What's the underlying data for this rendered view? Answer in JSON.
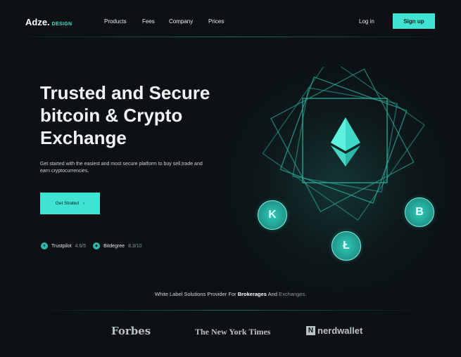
{
  "header": {
    "logo_main": "Adze.",
    "logo_sub": "DESIGN",
    "nav": [
      "Products",
      "Fees",
      "Company",
      "Prices"
    ],
    "login_label": "Log in",
    "signup_label": "Sign up"
  },
  "hero": {
    "title": "Trusted and Secure bitcoin & Crypto Exchange",
    "subtitle": "Get started with the easiest and most secure platform to buy sell,trade and earn cryptocurrencies.",
    "cta_label": "Get Strated",
    "cta_arrow": "›",
    "ratings": [
      {
        "name": "Trustpilot",
        "score": "4.6/5"
      },
      {
        "name": "Bitdegree",
        "score": "8.3/10"
      }
    ]
  },
  "coins": {
    "k_glyph": "K",
    "b_glyph": "B",
    "l_glyph": "Ł",
    "icons": [
      "ethereum-icon",
      "kyber-coin-icon",
      "bitcoin-coin-icon",
      "litecoin-coin-icon"
    ]
  },
  "partners": {
    "intro": "White Label Solutions Provider For",
    "bold": "Brokerages",
    "and": " And",
    "end": " Exchanges.",
    "brands": [
      "Forbes",
      "The New York Times",
      "nerdwallet"
    ]
  },
  "colors": {
    "accent": "#3ee3d2",
    "background": "#0c1114"
  }
}
